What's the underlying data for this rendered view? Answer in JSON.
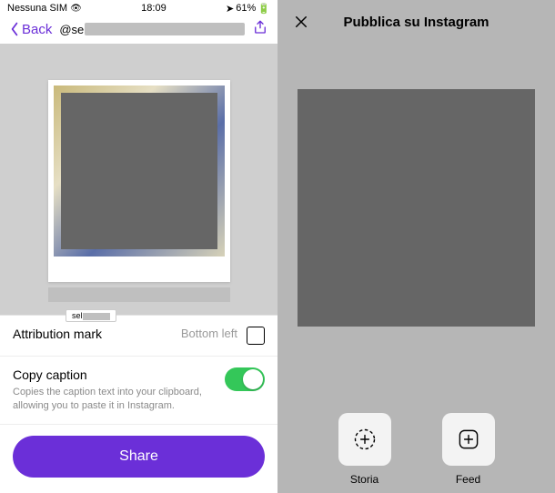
{
  "status_bar": {
    "carrier": "Nessuna SIM",
    "time": "18:09",
    "battery_pct": "61%"
  },
  "left": {
    "back_label": "Back",
    "username_prefix": "@se",
    "attrib": {
      "title": "Attribution mark",
      "value": "Bottom left"
    },
    "copy_caption": {
      "title": "Copy caption",
      "desc": "Copies the caption text into your clipboard, allowing you to paste it in Instagram.",
      "enabled": true
    },
    "share_label": "Share",
    "selection_tag_prefix": "sel"
  },
  "right": {
    "title": "Pubblica su Instagram",
    "action_story": "Storia",
    "action_feed": "Feed"
  },
  "colors": {
    "accent": "#6b2fd8",
    "toggle_on": "#34c759"
  }
}
